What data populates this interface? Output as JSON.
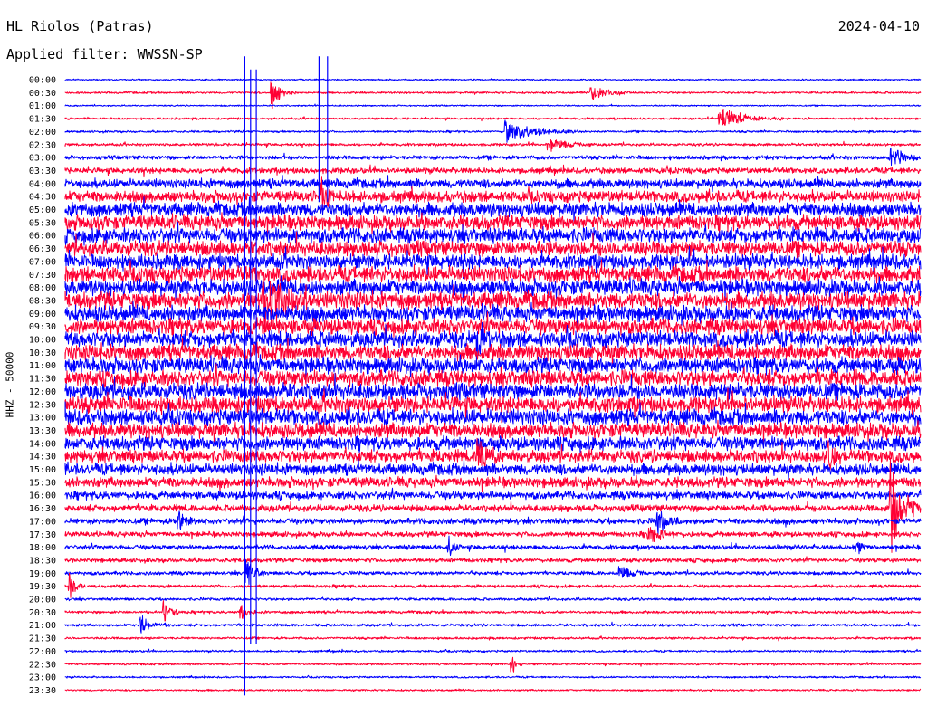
{
  "header": {
    "station": "HL Riolos (Patras)",
    "filter": "Applied filter: WWSSN-SP",
    "date": "2024-04-10"
  },
  "chart_data": {
    "type": "helicorder",
    "title": "HL Riolos (Patras)",
    "subtitle": "Applied filter: WWSSN-SP",
    "date": "2024-04-10",
    "ylabel": "HHZ - 50000",
    "row_labels": [
      "00:00",
      "00:30",
      "01:00",
      "01:30",
      "02:00",
      "02:30",
      "03:00",
      "03:30",
      "04:00",
      "04:30",
      "05:00",
      "05:30",
      "06:00",
      "06:30",
      "07:00",
      "07:30",
      "08:00",
      "08:30",
      "09:00",
      "09:30",
      "10:00",
      "10:30",
      "11:00",
      "11:30",
      "12:00",
      "12:30",
      "13:00",
      "13:30",
      "14:00",
      "14:30",
      "15:00",
      "15:30",
      "16:00",
      "16:30",
      "17:00",
      "17:30",
      "18:00",
      "18:30",
      "19:00",
      "19:30",
      "20:00",
      "20:30",
      "21:00",
      "21:30",
      "22:00",
      "22:30",
      "23:00",
      "23:30"
    ],
    "colors": [
      "#0000ff",
      "#ff0033"
    ],
    "noise_level": [
      0.6,
      0.9,
      0.6,
      0.9,
      0.9,
      1.2,
      1.8,
      2.5,
      4,
      5,
      6,
      6.5,
      6.5,
      6.5,
      6.5,
      7,
      7,
      7.5,
      7,
      7,
      7,
      7,
      7,
      7,
      7,
      7,
      7,
      6.5,
      6,
      5.5,
      5,
      4.5,
      3.5,
      3,
      2.6,
      2.3,
      2,
      1.8,
      1.6,
      1.4,
      1.2,
      1.2,
      1.2,
      1,
      0.9,
      0.9,
      0.8,
      0.8
    ],
    "events": [
      {
        "row": 1,
        "minute": 7.3,
        "amplitude": 12,
        "duration_min": 0.8
      },
      {
        "row": 1,
        "minute": 18.5,
        "amplitude": 6,
        "duration_min": 1.5
      },
      {
        "row": 3,
        "minute": 23,
        "amplitude": 10,
        "duration_min": 2.2
      },
      {
        "row": 4,
        "minute": 15.5,
        "amplitude": 10,
        "duration_min": 2.5
      },
      {
        "row": 5,
        "minute": 17,
        "amplitude": 6,
        "duration_min": 1.5
      },
      {
        "row": 6,
        "minute": 29,
        "amplitude": 10,
        "duration_min": 1
      },
      {
        "row": 9,
        "minute": 9,
        "amplitude": 14,
        "duration_min": 0.5
      },
      {
        "row": 17,
        "minute": 7,
        "amplitude": 25,
        "duration_min": 1.5
      },
      {
        "row": 20,
        "minute": 14.5,
        "amplitude": 20,
        "duration_min": 0.5
      },
      {
        "row": 29,
        "minute": 14.5,
        "amplitude": 15,
        "duration_min": 1
      },
      {
        "row": 29,
        "minute": 26.8,
        "amplitude": 15,
        "duration_min": 0.5
      },
      {
        "row": 33,
        "minute": 29,
        "amplitude": 40,
        "duration_min": 1
      },
      {
        "row": 34,
        "minute": 4,
        "amplitude": 10,
        "duration_min": 0.5
      },
      {
        "row": 34,
        "minute": 20.8,
        "amplitude": 12,
        "duration_min": 0.8
      },
      {
        "row": 35,
        "minute": 20.5,
        "amplitude": 10,
        "duration_min": 1
      },
      {
        "row": 36,
        "minute": 13.5,
        "amplitude": 10,
        "duration_min": 0.4
      },
      {
        "row": 36,
        "minute": 27.8,
        "amplitude": 10,
        "duration_min": 0.3
      },
      {
        "row": 38,
        "minute": 6.4,
        "amplitude": 15,
        "duration_min": 0.6
      },
      {
        "row": 38,
        "minute": 19.5,
        "amplitude": 6,
        "duration_min": 1
      },
      {
        "row": 39,
        "minute": 0.2,
        "amplitude": 10,
        "duration_min": 0.5
      },
      {
        "row": 41,
        "minute": 3.5,
        "amplitude": 8,
        "duration_min": 0.8
      },
      {
        "row": 41,
        "minute": 6.2,
        "amplitude": 6,
        "duration_min": 0.5
      },
      {
        "row": 42,
        "minute": 2.7,
        "amplitude": 8,
        "duration_min": 1
      },
      {
        "row": 45,
        "minute": 15.7,
        "amplitude": 8,
        "duration_min": 0.4
      }
    ],
    "spikes": [
      {
        "minute": 6.3,
        "row_from": 1,
        "row_to": 47
      },
      {
        "minute": 6.5,
        "row_from": 2,
        "row_to": 43
      },
      {
        "minute": 6.7,
        "row_from": 2,
        "row_to": 43
      },
      {
        "minute": 8.9,
        "row_from": 1,
        "row_to": 9
      },
      {
        "minute": 9.2,
        "row_from": 1,
        "row_to": 9
      }
    ]
  }
}
